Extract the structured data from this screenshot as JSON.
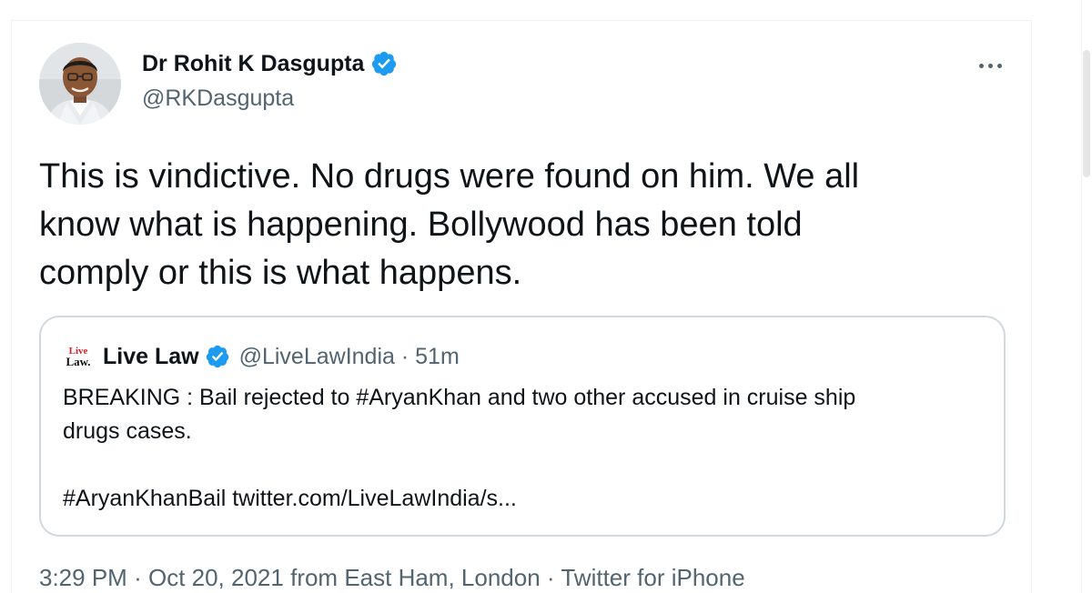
{
  "tweet": {
    "author_name": "Dr Rohit K Dasgupta",
    "author_handle": "@RKDasgupta",
    "text_lines": [
      "This is vindictive. No drugs were found on him. We all",
      "know what is happening. Bollywood has been told",
      "comply or this is what happens."
    ],
    "time": "3:29 PM",
    "date": "Oct 20, 2021",
    "location": "from East Ham, London",
    "source": "Twitter for iPhone",
    "separator": "·"
  },
  "quoted": {
    "avatar_text_top": "Live",
    "avatar_text_bottom": "Law.",
    "name": "Live Law",
    "handle": "@LiveLawIndia",
    "age": "51m",
    "text_line1": "BREAKING : Bail rejected to #AryanKhan and two other accused in cruise ship",
    "text_line2": "drugs cases.",
    "text_line3": "#AryanKhanBail twitter.com/LiveLawIndia/s..."
  },
  "colors": {
    "verified_badge": "#1d9bf0",
    "secondary_text": "#536471",
    "border": "#cfd9de"
  },
  "icons": {
    "verified": "verified-badge-icon",
    "more": "more-options-icon"
  }
}
